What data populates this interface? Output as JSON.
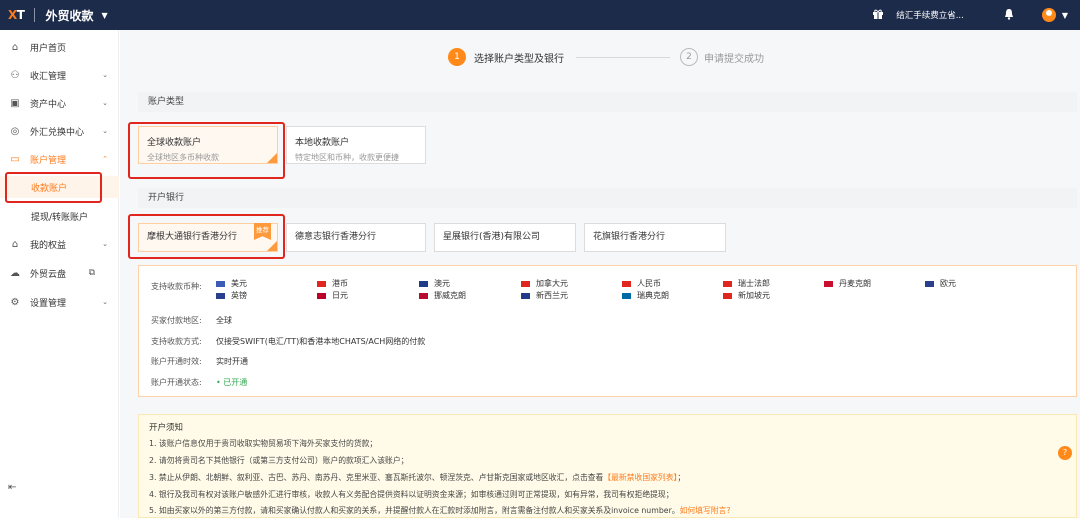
{
  "topbar": {
    "logo_x": "X",
    "logo_t": "T",
    "app_title": "外贸收款",
    "fee_notice": "结汇手续费立省..."
  },
  "sidebar": {
    "items": [
      {
        "label": "用户首页",
        "icon": "home-icon"
      },
      {
        "label": "收汇管理",
        "icon": "user-icon"
      },
      {
        "label": "资产中心",
        "icon": "wallet-icon"
      },
      {
        "label": "外汇兑换中心",
        "icon": "exchange-icon"
      },
      {
        "label": "账户管理",
        "icon": "card-icon"
      },
      {
        "label": "我的权益",
        "icon": "gift-icon"
      },
      {
        "label": "外贸云盘",
        "icon": "cloud-icon"
      },
      {
        "label": "设置管理",
        "icon": "gear-icon"
      }
    ],
    "subitems": [
      "收款账户",
      "提现/转账账户"
    ]
  },
  "steps": [
    {
      "num": "1",
      "label": "选择账户类型及银行"
    },
    {
      "num": "2",
      "label": "申请提交成功"
    }
  ],
  "account_type": {
    "heading": "账户类型",
    "cards": [
      {
        "title": "全球收款账户",
        "subtitle": "全球地区多币种收款"
      },
      {
        "title": "本地收款账户",
        "subtitle": "特定地区和币种，收款更便捷"
      }
    ]
  },
  "bank": {
    "heading": "开户银行",
    "recommend_tag": "推荐",
    "banks": [
      "摩根大通银行香港分行",
      "德意志银行香港分行",
      "星展银行(香港)有限公司",
      "花旗银行香港分行"
    ]
  },
  "details": {
    "currency_label": "支持收款币种:",
    "currencies": [
      {
        "name": "美元",
        "color": "#3c5bb5"
      },
      {
        "name": "港币",
        "color": "#e0261d"
      },
      {
        "name": "澳元",
        "color": "#1f3c88"
      },
      {
        "name": "加拿大元",
        "color": "#e0261d"
      },
      {
        "name": "人民币",
        "color": "#e0261d"
      },
      {
        "name": "瑞士法郎",
        "color": "#e0261d"
      },
      {
        "name": "丹麦克朗",
        "color": "#c8102e"
      },
      {
        "name": "欧元",
        "color": "#2b3f8f"
      },
      {
        "name": "英镑",
        "color": "#2b3f8f"
      },
      {
        "name": "日元",
        "color": "#bc002d"
      },
      {
        "name": "挪威克朗",
        "color": "#ba0c2f"
      },
      {
        "name": "新西兰元",
        "color": "#1f3c88"
      },
      {
        "name": "瑞典克朗",
        "color": "#006aa7"
      },
      {
        "name": "新加坡元",
        "color": "#e0261d"
      }
    ],
    "payer_region_label": "买家付款地区:",
    "payer_region_value": "全球",
    "method_label": "支持收款方式:",
    "method_value": "仅接受SWIFT(电汇/TT)和香港本地CHATS/ACH网络的付款",
    "timing_label": "账户开通时效:",
    "timing_value": "实时开通",
    "status_label": "账户开通状态:",
    "status_value": "已开通"
  },
  "notice": {
    "title": "开户须知",
    "line1": "1. 该账户信息仅用于贵司收取实物贸易项下海外买家支付的货款；",
    "line2": "2. 请勿将贵司名下其他银行（或第三方支付公司）账户的款项汇入该账户；",
    "line3_a": "3. 禁止从伊朗、北朝鲜、叙利亚、古巴、苏丹、南苏丹、克里米亚、塞瓦斯托波尔、顿涅茨克、卢甘斯克国家或地区收汇，点击查看",
    "line3_link": "【最新禁收国家列表】",
    "line3_b": "；",
    "line4": "4. 银行及我司有权对该账户敏感外汇进行审核，收款人有义务配合提供资料以证明资金来源；如审核通过则可正常提现，如有异常，我司有权拒绝提现；",
    "line5_a": "5. 如由买家以外的第三方付款，请和买家确认付款人和买家的关系，并提醒付款人在汇款时添加附言，附言需备注付款人和买家关系及invoice number。",
    "line5_link": "如何填写附言?"
  },
  "help_bubble": "?"
}
